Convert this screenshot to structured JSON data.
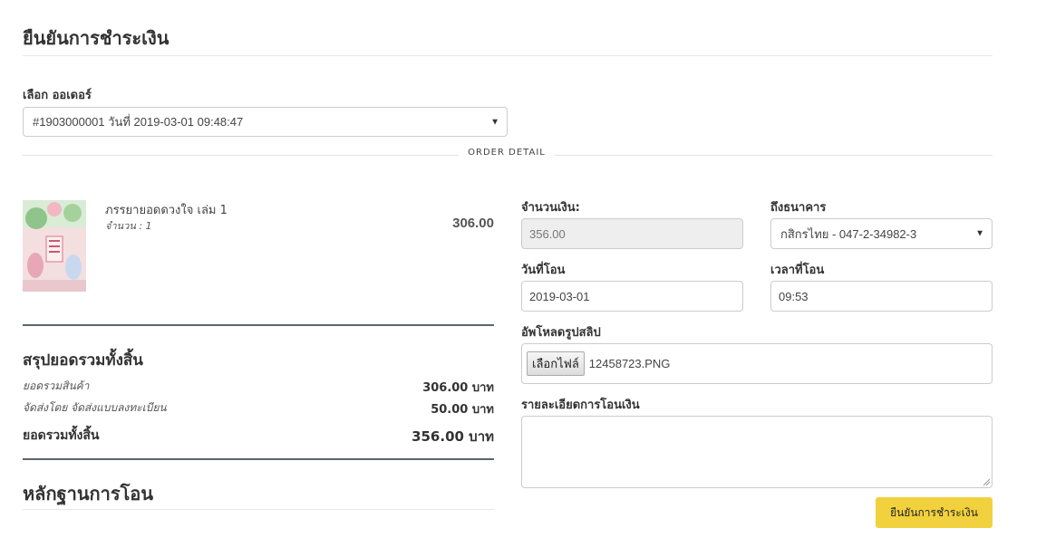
{
  "page": {
    "title": "ยืนยันการชำระเงิน"
  },
  "order_select": {
    "label": "เลือก ออเดอร์",
    "selected": "#1903000001 วันที่ 2019-03-01 09:48:47"
  },
  "order_detail_divider": "ORDER DETAIL",
  "product": {
    "name": "ภรรยายอดดวงใจ เล่ม 1",
    "qty_text": "จำนวน : 1",
    "price": "306.00"
  },
  "summary": {
    "title": "สรุปยอดรวมทั้งสิ้น",
    "rows": [
      {
        "label": "ยอดรวมสินค้า",
        "value": "306.00 บาท"
      },
      {
        "label": "จัดส่งโดย จัดส่งแบบลงทะเบียน",
        "value": "50.00 บาท"
      }
    ],
    "total_label": "ยอดรวมทั้งสิ้น",
    "total_value": "356.00 บาท"
  },
  "proof": {
    "title": "หลักฐานการโอน"
  },
  "form": {
    "amount_label": "จำนวนเงิน:",
    "amount_value": "356.00",
    "bank_label": "ถึงธนาคาร",
    "bank_value": "กสิกรไทย - 047-2-34982-3",
    "date_label": "วันที่โอน",
    "date_value": "2019-03-01",
    "time_label": "เวลาที่โอน",
    "time_value": "09:53",
    "upload_label": "อัพโหลดรูปสลิป",
    "upload_button": "เลือกไฟล์",
    "upload_filename": "12458723.PNG",
    "details_label": "รายละเอียดการโอนเงิน",
    "submit_label": "ยืนยันการชำระเงิน"
  },
  "colors": {
    "accent_button": "#f2d13e",
    "divider_dark": "#5a6670",
    "disabled_bg": "#eeeeee"
  },
  "icons": {
    "select_caret": "caret-down-icon",
    "product_image": "book-cover-image"
  }
}
